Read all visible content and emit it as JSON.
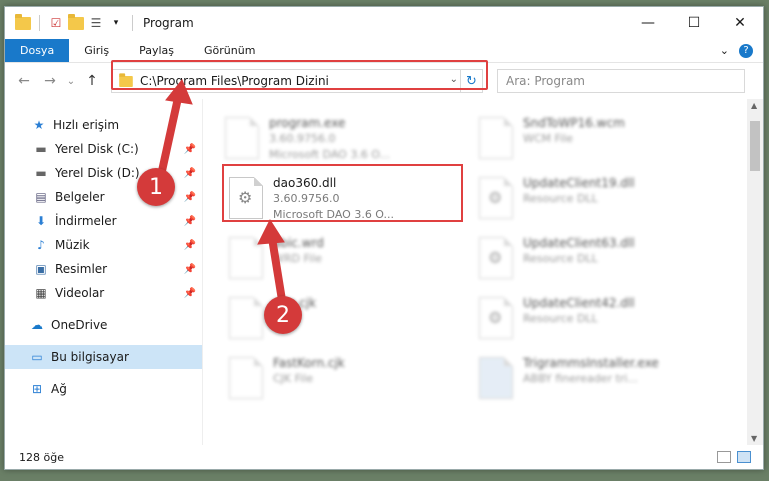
{
  "window": {
    "title": "Program",
    "controls": {
      "minimize": "—",
      "maximize": "☐",
      "close": "✕"
    }
  },
  "ribbon": {
    "tabs": [
      {
        "label": "Dosya",
        "active": true
      },
      {
        "label": "Giriş",
        "active": false
      },
      {
        "label": "Paylaş",
        "active": false
      },
      {
        "label": "Görünüm",
        "active": false
      }
    ],
    "expand": "⌄",
    "help": "?"
  },
  "nav": {
    "back": "←",
    "forward": "→",
    "recent": "⌄",
    "up": "↑",
    "address": "C:\\Program Files\\Program Dizini",
    "search_placeholder": "Ara: Program"
  },
  "sidebar": {
    "quick_access": "Hızlı erişim",
    "items": [
      {
        "label": "Yerel Disk (C:)",
        "icon": "drive-icon"
      },
      {
        "label": "Yerel Disk (D:)",
        "icon": "drive-icon"
      },
      {
        "label": "Belgeler",
        "icon": "documents-icon"
      },
      {
        "label": "İndirmeler",
        "icon": "download-icon"
      },
      {
        "label": "Müzik",
        "icon": "music-icon"
      },
      {
        "label": "Resimler",
        "icon": "pictures-icon"
      },
      {
        "label": "Videolar",
        "icon": "videos-icon"
      }
    ],
    "onedrive": "OneDrive",
    "this_pc": "Bu bilgisayar",
    "network": "Ağ"
  },
  "files": [
    {
      "name": "program.exe",
      "line2": "3.60.9756.0",
      "line3": "Microsoft DAO 3.6 O...",
      "blurred": true
    },
    {
      "name": "dao360.dll",
      "line2": "3.60.9756.0",
      "line3": "Microsoft DAO 3.6 O...",
      "blurred": false
    },
    {
      "name": "abic.wrd",
      "line2": "WRD File",
      "blurred": true
    },
    {
      "name": "ean.cjk",
      "line2": "File",
      "blurred": true
    },
    {
      "name": "FastKorn.cjk",
      "line2": "CJK File",
      "blurred": true
    },
    {
      "name": "SndToWP16.wcm",
      "line2": "WCM File",
      "blurred": true
    },
    {
      "name": "UpdateClient19.dll",
      "line2": "Resource DLL",
      "blurred": true
    },
    {
      "name": "UpdateClient63.dll",
      "line2": "Resource DLL",
      "blurred": true
    },
    {
      "name": "UpdateClient42.dll",
      "line2": "Resource DLL",
      "blurred": true
    },
    {
      "name": "TrigrammsInstaller.exe",
      "line2": "ABBY finereader tri...",
      "blurred": true
    }
  ],
  "status": {
    "count": "128 öğe"
  },
  "annotations": {
    "badge1": "1",
    "badge2": "2",
    "color": "#d43a3a"
  }
}
